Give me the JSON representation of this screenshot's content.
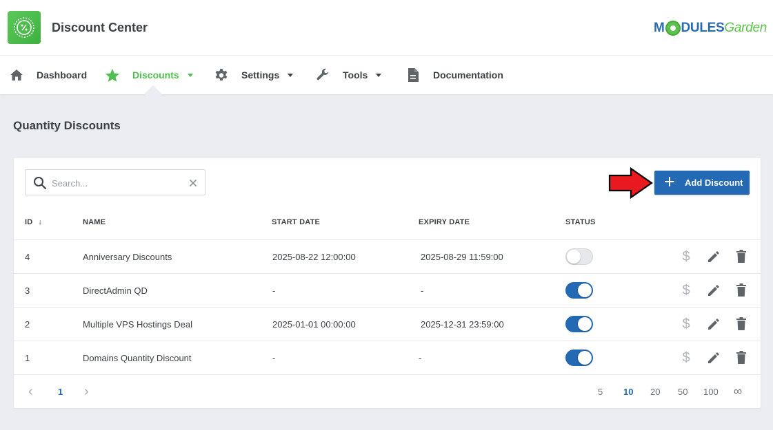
{
  "header": {
    "title": "Discount Center",
    "brand_modules": "M",
    "brand_dules": "DULES",
    "brand_garden": "Garden"
  },
  "nav": {
    "items": [
      {
        "label": "Dashboard",
        "icon": "home-icon"
      },
      {
        "label": "Discounts",
        "icon": "star-icon",
        "active": true,
        "dropdown": true
      },
      {
        "label": "Settings",
        "icon": "gear-icon",
        "dropdown": true
      },
      {
        "label": "Tools",
        "icon": "wrench-icon",
        "dropdown": true
      },
      {
        "label": "Documentation",
        "icon": "document-icon"
      }
    ]
  },
  "page": {
    "title": "Quantity Discounts"
  },
  "toolbar": {
    "search_placeholder": "Search...",
    "add_label": "Add Discount"
  },
  "table": {
    "columns": {
      "id": "ID",
      "sort_indicator": "↓",
      "name": "NAME",
      "start": "START DATE",
      "expiry": "EXPIRY DATE",
      "status": "STATUS"
    },
    "rows": [
      {
        "id": "4",
        "name": "Anniversary Discounts",
        "start": "2025-08-22 12:00:00",
        "expiry": "2025-08-29 11:59:00",
        "enabled": false
      },
      {
        "id": "3",
        "name": "DirectAdmin QD",
        "start": "-",
        "expiry": "-",
        "enabled": true
      },
      {
        "id": "2",
        "name": "Multiple VPS Hostings Deal",
        "start": "2025-01-01 00:00:00",
        "expiry": "2025-12-31 23:59:00",
        "enabled": true
      },
      {
        "id": "1",
        "name": "Domains Quantity Discount",
        "start": "-",
        "expiry": "-",
        "enabled": true
      }
    ],
    "dollar_symbol": "$"
  },
  "pagination": {
    "prev": "‹",
    "current": "1",
    "next": "›",
    "page_sizes": [
      "5",
      "10",
      "20",
      "50",
      "100",
      "∞"
    ],
    "selected_size": "10"
  },
  "colors": {
    "accent": "#2369b3",
    "nav_active": "#4fbf4f",
    "logo_green": "#4fbf4f",
    "arrow_red": "#e8191f"
  }
}
